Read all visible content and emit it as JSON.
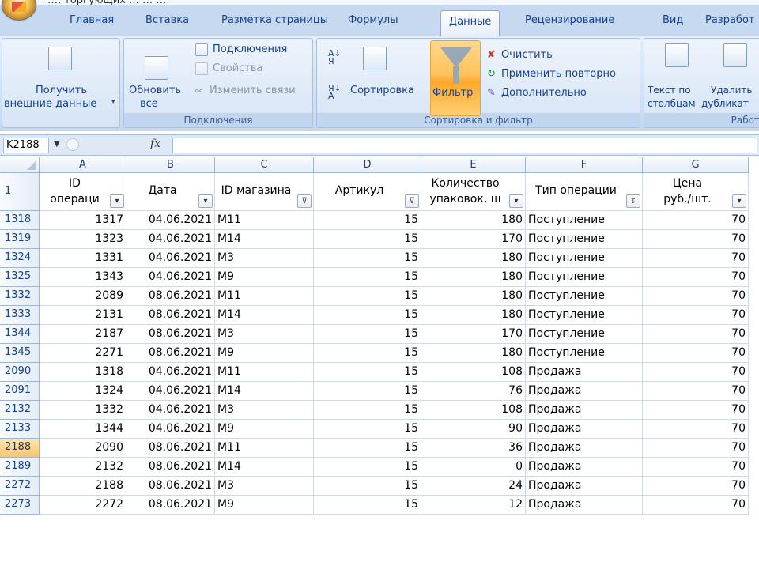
{
  "title_partial": "…, торгующих …                                 …                           …",
  "tabs": [
    "Главная",
    "Вставка",
    "Разметка страницы",
    "Формулы",
    "Данные",
    "Рецензирование",
    "Вид",
    "Разработ"
  ],
  "active_tab": "Данные",
  "ribbon": {
    "get_external": [
      "Получить",
      "внешние данные"
    ],
    "refresh": [
      "Обновить",
      "все"
    ],
    "connections": "Подключения",
    "properties": "Свойства",
    "edit_links": "Изменить связи",
    "group_connections": "Подключения",
    "sort": "Сортировка",
    "filter": "Фильтр",
    "clear": "Очистить",
    "reapply": "Применить повторно",
    "advanced": "Дополнительно",
    "group_sort_filter": "Сортировка и фильтр",
    "text_to_cols": [
      "Текст по",
      "столбцам"
    ],
    "remove_dups": [
      "Удалить",
      "дубликат"
    ],
    "group_data_tools": "Работ"
  },
  "namebox": "K2188",
  "fx": "fx",
  "columns": [
    "A",
    "B",
    "C",
    "D",
    "E",
    "F",
    "G"
  ],
  "header_row_num": "1",
  "headers": [
    [
      "ID",
      "операци"
    ],
    [
      "Дата"
    ],
    [
      "ID магазина"
    ],
    [
      "Артикул"
    ],
    [
      "Количество",
      "упаковок, ш"
    ],
    [
      "Тип операции"
    ],
    [
      "Цена",
      "руб./шт."
    ]
  ],
  "rows": [
    {
      "r": "1318",
      "a": "1317",
      "b": "04.06.2021",
      "c": "M11",
      "d": "15",
      "e": "180",
      "f": "Поступление",
      "g": "70"
    },
    {
      "r": "1319",
      "a": "1323",
      "b": "04.06.2021",
      "c": "M14",
      "d": "15",
      "e": "170",
      "f": "Поступление",
      "g": "70"
    },
    {
      "r": "1324",
      "a": "1331",
      "b": "04.06.2021",
      "c": "M3",
      "d": "15",
      "e": "180",
      "f": "Поступление",
      "g": "70"
    },
    {
      "r": "1325",
      "a": "1343",
      "b": "04.06.2021",
      "c": "M9",
      "d": "15",
      "e": "180",
      "f": "Поступление",
      "g": "70"
    },
    {
      "r": "1332",
      "a": "2089",
      "b": "08.06.2021",
      "c": "M11",
      "d": "15",
      "e": "180",
      "f": "Поступление",
      "g": "70"
    },
    {
      "r": "1333",
      "a": "2131",
      "b": "08.06.2021",
      "c": "M14",
      "d": "15",
      "e": "180",
      "f": "Поступление",
      "g": "70"
    },
    {
      "r": "1344",
      "a": "2187",
      "b": "08.06.2021",
      "c": "M3",
      "d": "15",
      "e": "170",
      "f": "Поступление",
      "g": "70"
    },
    {
      "r": "1345",
      "a": "2271",
      "b": "08.06.2021",
      "c": "M9",
      "d": "15",
      "e": "180",
      "f": "Поступление",
      "g": "70"
    },
    {
      "r": "2090",
      "a": "1318",
      "b": "04.06.2021",
      "c": "M11",
      "d": "15",
      "e": "108",
      "f": "Продажа",
      "g": "70"
    },
    {
      "r": "2091",
      "a": "1324",
      "b": "04.06.2021",
      "c": "M14",
      "d": "15",
      "e": "76",
      "f": "Продажа",
      "g": "70"
    },
    {
      "r": "2132",
      "a": "1332",
      "b": "04.06.2021",
      "c": "M3",
      "d": "15",
      "e": "108",
      "f": "Продажа",
      "g": "70"
    },
    {
      "r": "2133",
      "a": "1344",
      "b": "04.06.2021",
      "c": "M9",
      "d": "15",
      "e": "90",
      "f": "Продажа",
      "g": "70"
    },
    {
      "r": "2188",
      "a": "2090",
      "b": "08.06.2021",
      "c": "M11",
      "d": "15",
      "e": "36",
      "f": "Продажа",
      "g": "70"
    },
    {
      "r": "2189",
      "a": "2132",
      "b": "08.06.2021",
      "c": "M14",
      "d": "15",
      "e": "0",
      "f": "Продажа",
      "g": "70"
    },
    {
      "r": "2272",
      "a": "2188",
      "b": "08.06.2021",
      "c": "M3",
      "d": "15",
      "e": "24",
      "f": "Продажа",
      "g": "70"
    },
    {
      "r": "2273",
      "a": "2272",
      "b": "08.06.2021",
      "c": "M9",
      "d": "15",
      "e": "12",
      "f": "Продажа",
      "g": "70"
    }
  ],
  "selected_row": "2188",
  "filter_icons": {
    "plain": "▾",
    "filtered": "⊽",
    "sorted": "↕"
  }
}
